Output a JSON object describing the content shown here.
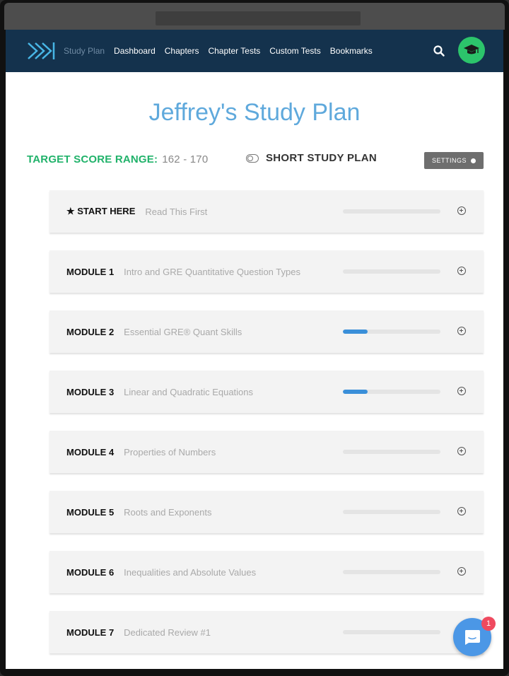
{
  "nav": {
    "links": [
      "Study Plan",
      "Dashboard",
      "Chapters",
      "Chapter Tests",
      "Custom Tests",
      "Bookmarks"
    ],
    "active": "Study Plan",
    "icons": [
      "logo-icon",
      "search-icon",
      "graduation-cap-icon"
    ]
  },
  "page": {
    "title": "Jeffrey's Study Plan",
    "target_label": "TARGET SCORE RANGE:",
    "target_range": "162 - 170",
    "short_plan_label": "SHORT STUDY PLAN",
    "settings_label": "SETTINGS"
  },
  "modules": [
    {
      "label": "★ START HERE",
      "title": "Read This First",
      "progress": 0
    },
    {
      "label": "MODULE 1",
      "title": "Intro and GRE Quantitative Question Types",
      "progress": 0
    },
    {
      "label": "MODULE 2",
      "title": "Essential GRE® Quant Skills",
      "progress": 0.25
    },
    {
      "label": "MODULE 3",
      "title": "Linear and Quadratic Equations",
      "progress": 0.25
    },
    {
      "label": "MODULE 4",
      "title": "Properties of Numbers",
      "progress": 0
    },
    {
      "label": "MODULE 5",
      "title": "Roots and Exponents",
      "progress": 0
    },
    {
      "label": "MODULE 6",
      "title": "Inequalities and Absolute Values",
      "progress": 0
    },
    {
      "label": "MODULE 7",
      "title": "Dedicated Review #1",
      "progress": 0
    }
  ],
  "chat": {
    "badge": "1"
  },
  "colors": {
    "nav_bg": "#14324d",
    "title": "#5fa9dc",
    "target": "#20b26a",
    "progress": "#3a8fd9",
    "avatar": "#2cc46b",
    "chat": "#4b97e6",
    "badge": "#ef4a5f"
  }
}
